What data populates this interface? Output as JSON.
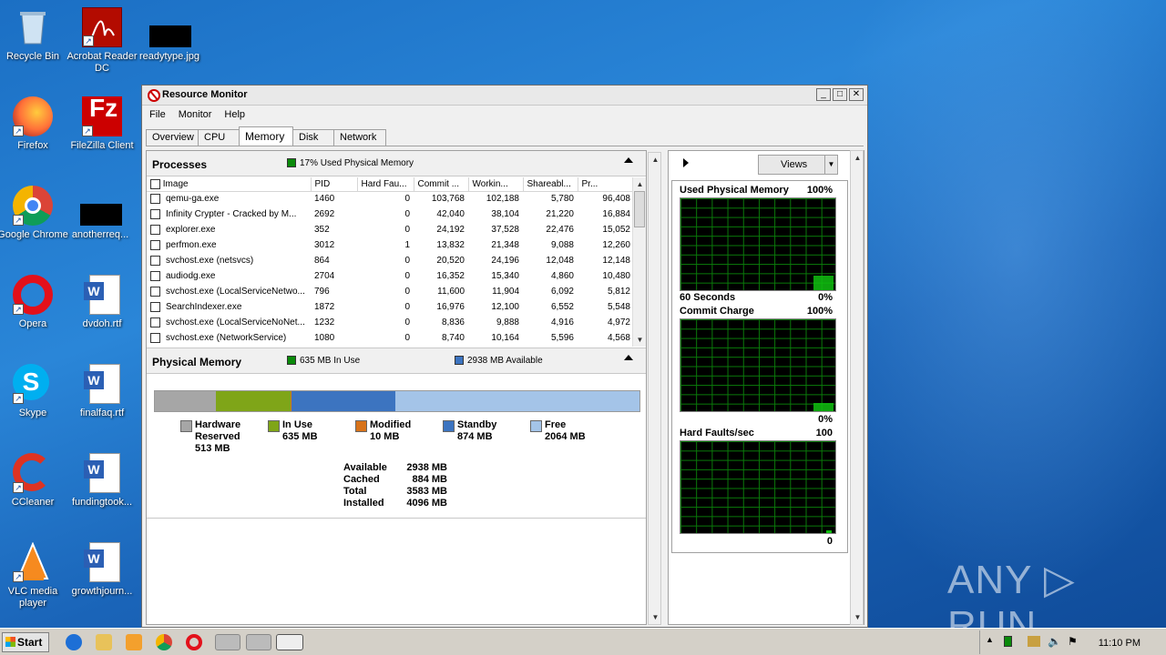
{
  "desktop": {
    "icons": [
      {
        "label": "Recycle Bin"
      },
      {
        "label": "Acrobat Reader DC"
      },
      {
        "label": "readytype.jpg"
      },
      {
        "label": "Firefox"
      },
      {
        "label": "FileZilla Client"
      },
      {
        "label": "Google Chrome"
      },
      {
        "label": "anotherreq..."
      },
      {
        "label": "Opera"
      },
      {
        "label": "dvdoh.rtf"
      },
      {
        "label": "Skype"
      },
      {
        "label": "finalfaq.rtf"
      },
      {
        "label": "CCleaner"
      },
      {
        "label": "fundingtook..."
      },
      {
        "label": "VLC media player"
      },
      {
        "label": "growthjourn..."
      }
    ],
    "watermark": "ANY ▷ RUN"
  },
  "window": {
    "title": "Resource Monitor",
    "menu": [
      "File",
      "Monitor",
      "Help"
    ],
    "tabs": [
      "Overview",
      "CPU",
      "Memory",
      "Disk",
      "Network"
    ],
    "active_tab": "Memory"
  },
  "processes": {
    "title": "Processes",
    "legend": "17% Used Physical Memory",
    "columns": [
      "Image",
      "PID",
      "Hard Fau...",
      "Commit ...",
      "Workin...",
      "Shareabl...",
      "Pr..."
    ],
    "rows": [
      [
        "qemu-ga.exe",
        "1460",
        "0",
        "103,768",
        "102,188",
        "5,780",
        "96,408"
      ],
      [
        "Infinity Crypter - Cracked by M...",
        "2692",
        "0",
        "42,040",
        "38,104",
        "21,220",
        "16,884"
      ],
      [
        "explorer.exe",
        "352",
        "0",
        "24,192",
        "37,528",
        "22,476",
        "15,052"
      ],
      [
        "perfmon.exe",
        "3012",
        "1",
        "13,832",
        "21,348",
        "9,088",
        "12,260"
      ],
      [
        "svchost.exe (netsvcs)",
        "864",
        "0",
        "20,520",
        "24,196",
        "12,048",
        "12,148"
      ],
      [
        "audiodg.exe",
        "2704",
        "0",
        "16,352",
        "15,340",
        "4,860",
        "10,480"
      ],
      [
        "svchost.exe (LocalServiceNetwo...",
        "796",
        "0",
        "11,600",
        "11,904",
        "6,092",
        "5,812"
      ],
      [
        "SearchIndexer.exe",
        "1872",
        "0",
        "16,976",
        "12,100",
        "6,552",
        "5,548"
      ],
      [
        "svchost.exe (LocalServiceNoNet...",
        "1232",
        "0",
        "8,836",
        "9,888",
        "4,916",
        "4,972"
      ],
      [
        "svchost.exe (NetworkService)",
        "1080",
        "0",
        "8,740",
        "10,164",
        "5,596",
        "4,568"
      ]
    ]
  },
  "physical": {
    "title": "Physical Memory",
    "in_use_legend": "635 MB In Use",
    "available_legend": "2938 MB Available",
    "segments": [
      {
        "name": "Hardware Reserved",
        "mb": 513,
        "color": "#a6a6a6"
      },
      {
        "name": "In Use",
        "mb": 635,
        "color": "#7fa518"
      },
      {
        "name": "Modified",
        "mb": 10,
        "color": "#d8731a"
      },
      {
        "name": "Standby",
        "mb": 874,
        "color": "#3c74c0"
      },
      {
        "name": "Free",
        "mb": 2064,
        "color": "#a4c4e8"
      }
    ],
    "legend": [
      {
        "line1": "Hardware",
        "line2": "Reserved",
        "line3": "513 MB"
      },
      {
        "line1": "In Use",
        "line2": "635 MB",
        "line3": ""
      },
      {
        "line1": "Modified",
        "line2": "10 MB",
        "line3": ""
      },
      {
        "line1": "Standby",
        "line2": "874 MB",
        "line3": ""
      },
      {
        "line1": "Free",
        "line2": "2064 MB",
        "line3": ""
      }
    ],
    "totals": [
      {
        "label": "Available",
        "value": "2938 MB"
      },
      {
        "label": "Cached",
        "value": "884 MB"
      },
      {
        "label": "Total",
        "value": "3583 MB"
      },
      {
        "label": "Installed",
        "value": "4096 MB"
      }
    ]
  },
  "right": {
    "views_label": "Views",
    "graphs": [
      {
        "title": "Used Physical Memory",
        "max": "100%",
        "bottom_left": "60 Seconds",
        "bottom_right": "0%"
      },
      {
        "title": "Commit Charge",
        "max": "100%",
        "bottom_left": "",
        "bottom_right": "0%"
      },
      {
        "title": "Hard Faults/sec",
        "max": "100",
        "bottom_left": "",
        "bottom_right": "0"
      }
    ]
  },
  "taskbar": {
    "start": "Start",
    "clock": "11:10 PM"
  }
}
